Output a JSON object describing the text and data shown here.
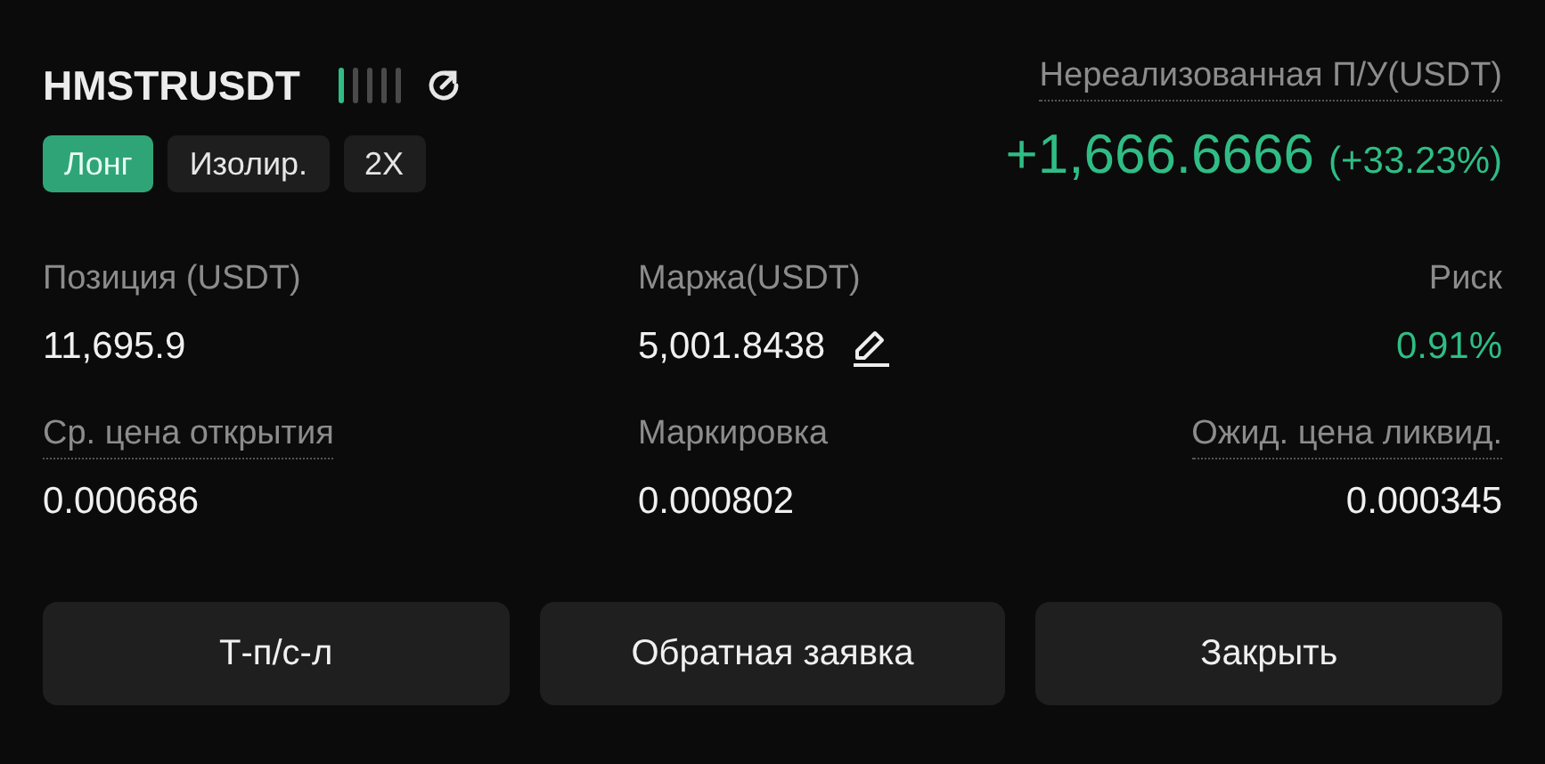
{
  "symbol": "HMSTRUSDT",
  "risk_meter": {
    "level": 0.2
  },
  "tags": [
    {
      "label": "Лонг",
      "kind": "side"
    },
    {
      "label": "Изолир.",
      "kind": "plain"
    },
    {
      "label": "2X",
      "kind": "plain"
    }
  ],
  "pnl": {
    "label": "Нереализованная П/У(USDT)",
    "value": "+1,666.6666",
    "percent": "(+33.23%)"
  },
  "fields": [
    {
      "label": "Позиция (USDT)",
      "value": "11,695.9",
      "underlined": false,
      "kind": "plain"
    },
    {
      "label": "Маржа(USDT)",
      "value": "5,001.8438",
      "underlined": false,
      "kind": "editable"
    },
    {
      "label": "Риск",
      "value": "0.91%",
      "underlined": false,
      "kind": "positive"
    },
    {
      "label": "Ср. цена открытия",
      "value": "0.000686",
      "underlined": true,
      "kind": "plain"
    },
    {
      "label": "Маркировка",
      "value": "0.000802",
      "underlined": false,
      "kind": "plain"
    },
    {
      "label": "Ожид. цена ликвид.",
      "value": "0.000345",
      "underlined": true,
      "kind": "plain"
    }
  ],
  "buttons": [
    "Т-п/с-л",
    "Обратная заявка",
    "Закрыть"
  ]
}
